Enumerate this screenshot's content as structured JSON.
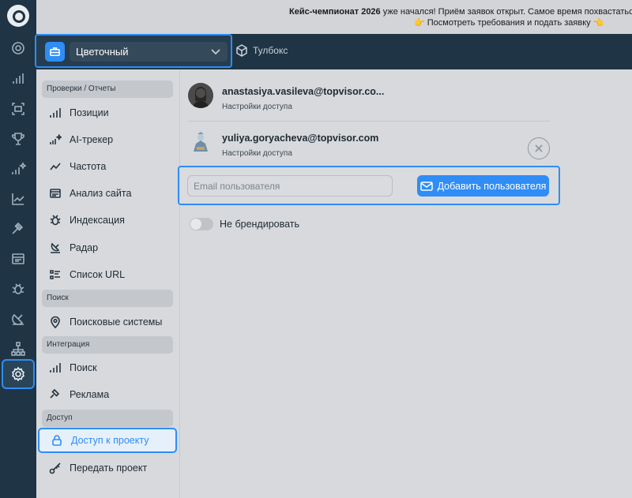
{
  "banner": {
    "line1_bold": "Кейс-чемпионат 2026",
    "line1_rest": " уже начался! Приём заявок открыт. Самое время похвастаться лучш",
    "line2": "👉 Посмотреть требования и подать заявку 👈"
  },
  "topbar": {
    "project_name": "Цветочный",
    "toolbox_label": "Тулбокс"
  },
  "nav": {
    "sections": [
      {
        "title": "Проверки / Отчеты"
      },
      {
        "title": "Поиск"
      },
      {
        "title": "Интеграция"
      },
      {
        "title": "Доступ"
      }
    ],
    "items": [
      {
        "label": "Позиции",
        "icon": "bar-chart-icon"
      },
      {
        "label": "AI-трекер",
        "icon": "ai-chart-icon"
      },
      {
        "label": "Частота",
        "icon": "trend-line-icon"
      },
      {
        "label": "Анализ сайта",
        "icon": "site-audit-icon"
      },
      {
        "label": "Индексация",
        "icon": "bug-icon"
      },
      {
        "label": "Радар",
        "icon": "radar-icon"
      },
      {
        "label": "Список URL",
        "icon": "list-icon"
      },
      {
        "label": "Поисковые системы",
        "icon": "location-pin-icon"
      },
      {
        "label": "Поиск",
        "icon": "bar-chart-icon"
      },
      {
        "label": "Реклама",
        "icon": "gavel-icon"
      },
      {
        "label": "Доступ к проекту",
        "icon": "lock-icon",
        "active": true
      },
      {
        "label": "Передать проект",
        "icon": "key-icon"
      }
    ]
  },
  "users": [
    {
      "email": "anastasiya.vasileva@topvisor.co...",
      "access": "Настройки доступа"
    },
    {
      "email": "yuliya.goryacheva@topvisor.com",
      "access": "Настройки доступа"
    }
  ],
  "add_user": {
    "placeholder": "Email пользователя",
    "button_label": "Добавить пользователя"
  },
  "branding": {
    "toggle_label": "Не брендировать",
    "toggle_on": false
  },
  "colors": {
    "accent": "#2f8df5",
    "rail_bg": "#1f3444",
    "content_bg": "#d7d9dc"
  }
}
